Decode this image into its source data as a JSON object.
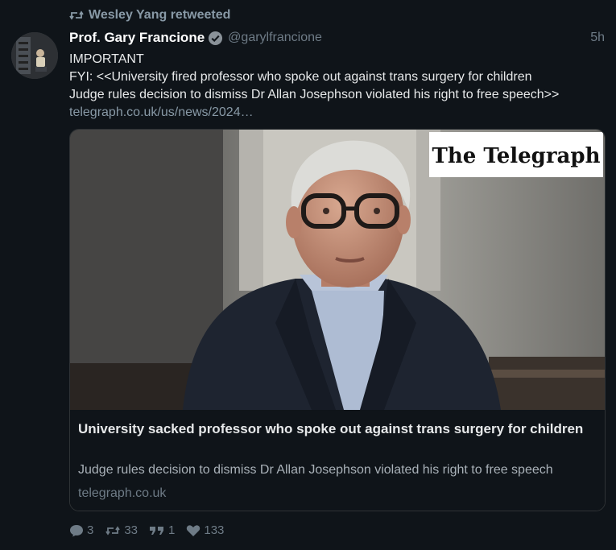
{
  "retweet": {
    "label": "Wesley Yang retweeted",
    "icon": "retweet-icon"
  },
  "author": {
    "display_name": "Prof. Gary Francione",
    "handle": "@garylfrancione",
    "verified": true,
    "time": "5h"
  },
  "tweet": {
    "line1": "IMPORTANT",
    "line2": "FYI: <<University fired professor who spoke out against trans surgery for children",
    "line3": "Judge rules decision to dismiss Dr Allan Josephson violated his right to free speech>>",
    "link": "telegraph.co.uk/us/news/2024…"
  },
  "card": {
    "brand": "The Telegraph",
    "title": "University sacked professor who spoke out against trans surgery for children",
    "description": "Judge rules decision to dismiss Dr Allan Josephson violated his right to free speech",
    "domain": "telegraph.co.uk"
  },
  "actions": {
    "replies": "3",
    "retweets": "33",
    "quotes": "1",
    "likes": "133"
  },
  "colors": {
    "background": "#0f1419",
    "muted": "#6e7b86",
    "verified": "#8a9299"
  }
}
